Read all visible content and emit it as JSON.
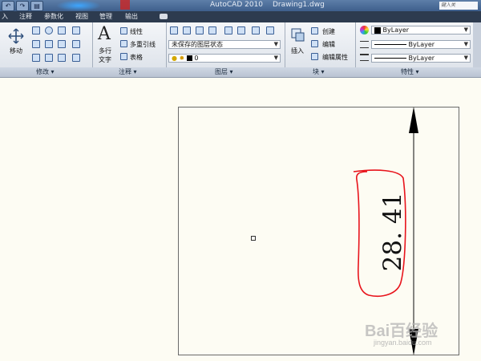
{
  "title_bar": {
    "app_title": "AutoCAD 2010",
    "doc_title": "Drawing1.dwg",
    "search_placeholder": "键入关"
  },
  "menu_tabs": [
    {
      "label": "入"
    },
    {
      "label": "注释"
    },
    {
      "label": "参数化"
    },
    {
      "label": "视图"
    },
    {
      "label": "管理"
    },
    {
      "label": "输出"
    }
  ],
  "ribbon": {
    "modify": {
      "move_label": "移动",
      "panel_label": "修改 ▾"
    },
    "annotation": {
      "text_label_line1": "多行",
      "text_label_line2": "文字",
      "text_glyph": "A",
      "linear_label": "线性",
      "multileader_label": "多重引线",
      "table_label": "表格",
      "panel_label": "注释 ▾"
    },
    "layers": {
      "layer_state": "未保存的图层状态",
      "current_layer": "0",
      "panel_label": "图层 ▾"
    },
    "block": {
      "insert_label": "插入",
      "create_label": "创建",
      "edit_label": "编辑",
      "edit_attr_label": "编辑属性",
      "panel_label": "块 ▾"
    },
    "properties": {
      "color": "ByLayer",
      "linetype": "ByLayer",
      "lineweight": "ByLayer",
      "panel_label": "特性 ▾"
    }
  },
  "drawing": {
    "dimension_text": "28. 41",
    "annotation_color": "#e8141c"
  },
  "watermark": {
    "brand": "Bai百经验",
    "url": "jingyan.baidu.com"
  }
}
